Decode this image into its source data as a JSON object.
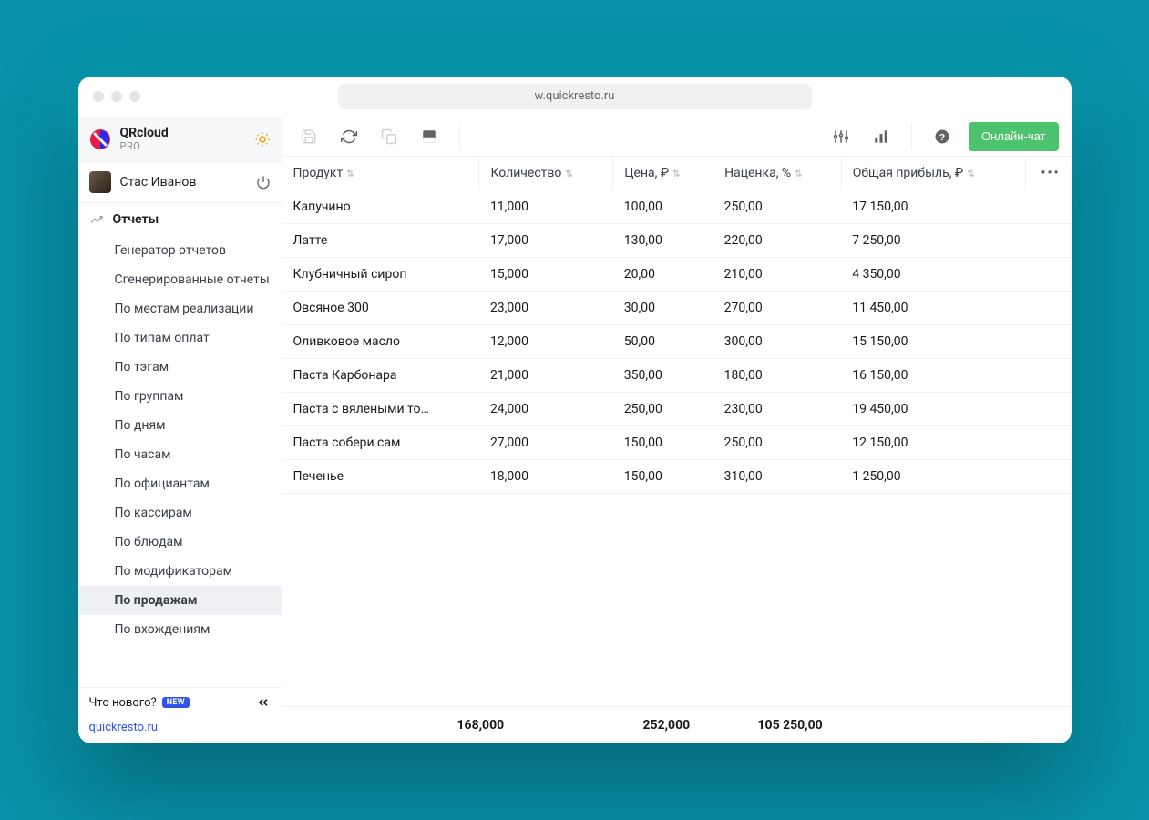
{
  "url": "w.quickresto.ru",
  "brand": {
    "title": "QRcloud",
    "sub": "PRO"
  },
  "user": {
    "name": "Стас Иванов"
  },
  "section_title": "Отчеты",
  "nav": [
    "Генератор отчетов",
    "Сгенерированные отчеты",
    "По местам реализации",
    "По типам оплат",
    "По тэгам",
    "По группам",
    "По дням",
    "По часам",
    "По официантам",
    "По кассирам",
    "По блюдам",
    "По модификаторам",
    "По продажам",
    "По вхождениям"
  ],
  "nav_active_index": 12,
  "whats_new": "Что нового?",
  "new_badge": "NEW",
  "site_link": "quickresto.ru",
  "chat_label": "Онлайн-чат",
  "columns": [
    "Продукт",
    "Количество",
    "Цена, ₽",
    "Наценка, %",
    "Общая прибыль, ₽"
  ],
  "rows": [
    {
      "product": "Капучино",
      "qty": "11,000",
      "price": "100,00",
      "markup": "250,00",
      "profit": "17 150,00"
    },
    {
      "product": "Латте",
      "qty": "17,000",
      "price": "130,00",
      "markup": "220,00",
      "profit": "7 250,00"
    },
    {
      "product": "Клубничный сироп",
      "qty": "15,000",
      "price": "20,00",
      "markup": "210,00",
      "profit": "4 350,00"
    },
    {
      "product": "Овсяное 300",
      "qty": "23,000",
      "price": "30,00",
      "markup": "270,00",
      "profit": "11 450,00"
    },
    {
      "product": "Оливковое масло",
      "qty": "12,000",
      "price": "50,00",
      "markup": "300,00",
      "profit": "15 150,00"
    },
    {
      "product": "Паста Карбонара",
      "qty": "21,000",
      "price": "350,00",
      "markup": "180,00",
      "profit": "16 150,00"
    },
    {
      "product": "Паста с вялеными то…",
      "qty": "24,000",
      "price": "250,00",
      "markup": "230,00",
      "profit": "19 450,00"
    },
    {
      "product": "Паста собери сам",
      "qty": "27,000",
      "price": "150,00",
      "markup": "250,00",
      "profit": "12 150,00"
    },
    {
      "product": "Печенье",
      "qty": "18,000",
      "price": "150,00",
      "markup": "310,00",
      "profit": "1 250,00"
    }
  ],
  "totals": {
    "qty": "168,000",
    "markup": "252,000",
    "profit": "105 250,00"
  }
}
